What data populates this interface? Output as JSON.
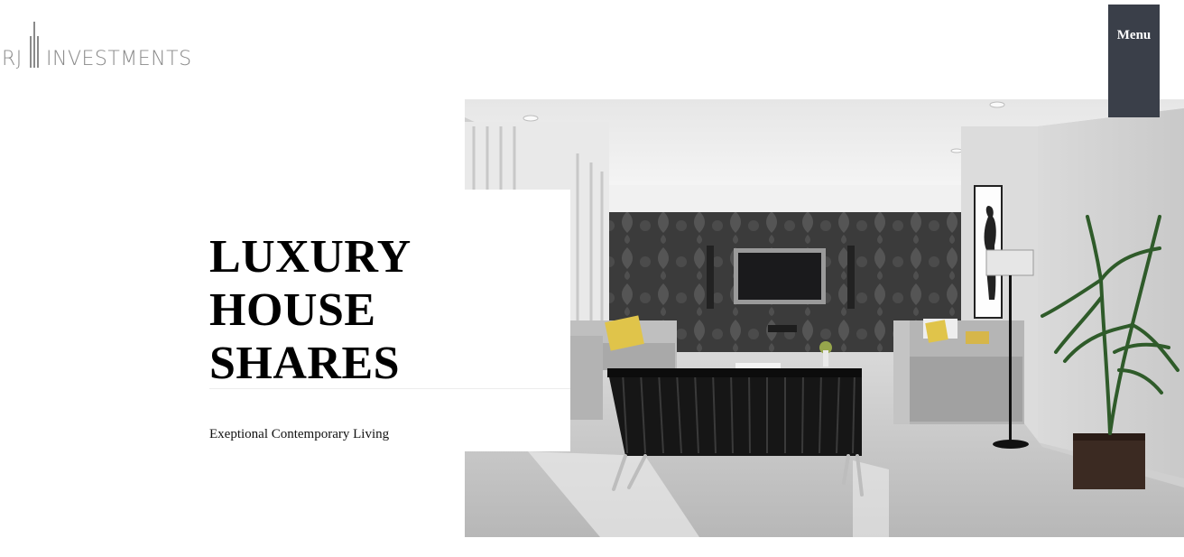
{
  "header": {
    "logo": {
      "prefix": "RJ",
      "name": "INVESTMENTS"
    },
    "menu_label": "Menu"
  },
  "hero": {
    "title_lines": [
      "LUXURY",
      "HOUSE",
      "SHARES"
    ],
    "subtitle": "Exeptional Contemporary Living",
    "image": "living-room-photo"
  },
  "colors": {
    "menu_bg": "#3a3f49",
    "logo_gray": "#8a8a8a",
    "text": "#000000"
  }
}
